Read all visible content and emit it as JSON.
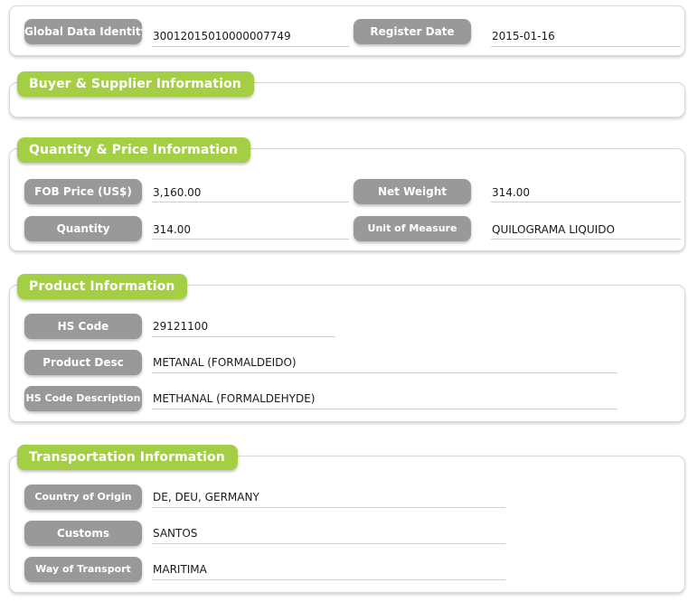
{
  "theme": {
    "accent_green": "#a4ce43",
    "label_gray": "#999999",
    "card_bg": "#ffffff",
    "text": "#1a1a1a",
    "rule": "#cfcfcf"
  },
  "sections": [
    {
      "id": "identity",
      "tab": null,
      "fields": [
        {
          "label": "Global Data Identity",
          "value": "30012015010000007749",
          "column": "left"
        },
        {
          "label": "Register Date",
          "value": "2015-01-16",
          "column": "right"
        }
      ]
    },
    {
      "id": "buyer-supplier",
      "tab": "Buyer & Supplier Information",
      "fields": []
    },
    {
      "id": "quantity-price",
      "tab": "Quantity & Price Information",
      "fields": [
        {
          "label": "FOB Price (US$)",
          "value": "3,160.00",
          "column": "left"
        },
        {
          "label": "Net Weight",
          "value": "314.00",
          "column": "right"
        },
        {
          "label": "Quantity",
          "value": "314.00",
          "column": "left"
        },
        {
          "label": "Unit of Measure",
          "value": "QUILOGRAMA LIQUIDO",
          "column": "right"
        }
      ]
    },
    {
      "id": "product",
      "tab": "Product Information",
      "fields": [
        {
          "label": "HS Code",
          "value": "29121100",
          "column": "left"
        },
        {
          "label": "Product Desc",
          "value": "METANAL (FORMALDEIDO)",
          "column": "left"
        },
        {
          "label": "HS Code Description",
          "value": "METHANAL (FORMALDEHYDE)",
          "column": "left"
        }
      ]
    },
    {
      "id": "transportation",
      "tab": "Transportation Information",
      "fields": [
        {
          "label": "Country of Origin",
          "value": "DE, DEU, GERMANY",
          "column": "left"
        },
        {
          "label": "Customs",
          "value": "SANTOS",
          "column": "left"
        },
        {
          "label": "Way of Transport",
          "value": "MARITIMA",
          "column": "left"
        }
      ]
    }
  ]
}
